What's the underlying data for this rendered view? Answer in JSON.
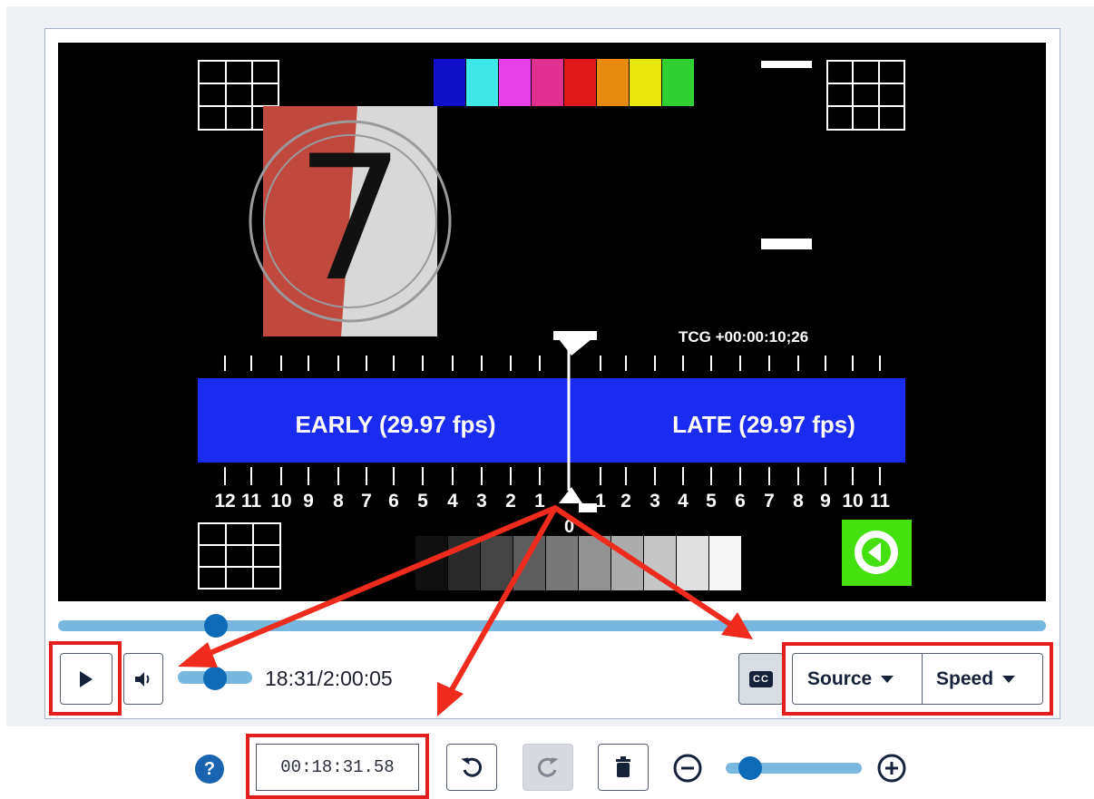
{
  "video": {
    "tcg_text": "TCG +00:00:10;26",
    "early_label": "EARLY (29.97 fps)",
    "late_label": "LATE (29.97 fps)",
    "countdown_number": "7",
    "center_zero": "0",
    "scale_left": [
      "12",
      "11",
      "10",
      "9",
      "8",
      "7",
      "6",
      "5",
      "4",
      "3",
      "2",
      "1"
    ],
    "scale_right": [
      "1",
      "2",
      "3",
      "4",
      "5",
      "6",
      "7",
      "8",
      "9",
      "10",
      "11"
    ],
    "color_bars": [
      "#1010c8",
      "#3ee8e8",
      "#e840e8",
      "#e03090",
      "#e01818",
      "#e88a10",
      "#e8e810",
      "#30d030"
    ],
    "gray_steps": [
      "#101010",
      "#2a2a2a",
      "#444444",
      "#5e5e5e",
      "#787878",
      "#929292",
      "#acacac",
      "#c6c6c6",
      "#e0e0e0",
      "#f6f6f6"
    ]
  },
  "player": {
    "progress_fraction": 0.16,
    "volume_fraction": 0.5,
    "time_display": "18:31/2:00:05",
    "cc_label": "CC",
    "source_label": "Source",
    "speed_label": "Speed"
  },
  "toolbar": {
    "help_label": "?",
    "timecode_value": "00:18:31.58",
    "zoom_fraction": 0.18
  },
  "colors": {
    "accent": "#0e6bb7",
    "track": "#78b7e0",
    "highlight": "#e51e1e",
    "banner_blue": "#1a2cf0"
  }
}
